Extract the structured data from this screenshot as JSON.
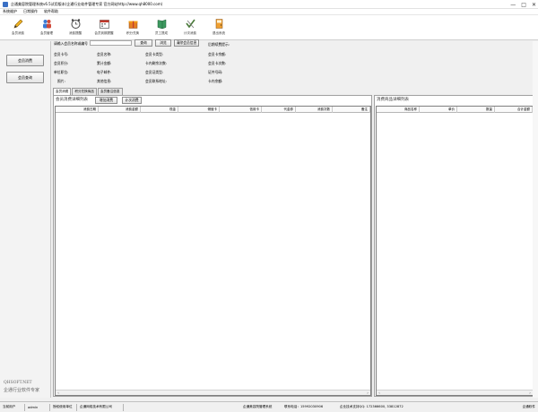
{
  "window": {
    "title": "企通美容院管理系统v6.5试用版本(企通行业软件管理专家 官方网站http://www.qh8000.com)",
    "controls": [
      "—",
      "□",
      "✕"
    ]
  },
  "menu": [
    "系统维护",
    "日常操作",
    "软件帮助"
  ],
  "toolbar": [
    {
      "label": "会员消费",
      "icon": "pencil-icon",
      "color": "#e9a21b"
    },
    {
      "label": "会员管理",
      "icon": "members-icon",
      "color": "#3a7bd5"
    },
    {
      "label": "消费提醒",
      "icon": "alarm-clock-icon",
      "color": "#555555"
    },
    {
      "label": "会员到期提醒",
      "icon": "calendar-icon",
      "color": "#c0392b"
    },
    {
      "label": "积分兑换",
      "icon": "gift-icon",
      "color": "#e67e22"
    },
    {
      "label": "员工提成",
      "icon": "book-icon",
      "color": "#2c8a4b"
    },
    {
      "label": "计次消费",
      "icon": "tick-icon",
      "color": "#4a7a3a"
    },
    {
      "label": "退出系统",
      "icon": "exit-icon",
      "color": "#d35400"
    }
  ],
  "sidebar": {
    "buttons": [
      "会员消费",
      "会员查询"
    ],
    "brand_line1": "QHSOFT.NET",
    "brand_line2": "企通行业软件专家"
  },
  "form": {
    "prompt": "请输入会员名称或编号",
    "query_button": "查询",
    "browse_button": "浏览",
    "clear_button": "清除会员信息",
    "labels": {
      "card_no": "会员卡号:",
      "name": "会员名称:",
      "card_type": "会员卡类型:",
      "card_balance": "会员卡余额:",
      "points": "会员积分:",
      "total_spend": "累计金额:",
      "remaining_times": "卡内剩余次数:",
      "card_times": "会员卡次数:",
      "unit": "单位职位:",
      "email": "电子邮件:",
      "cert_type": "会员证类型:",
      "member_id": "证件号码:",
      "photo": "照片:",
      "other_info": "其他信息:",
      "address": "会员联系地址:",
      "card_amount": "卡内余额:",
      "birthday_reminder": "后期续费提示:"
    }
  },
  "tabs": [
    "会员消费",
    "积分兑换商品",
    "会员备注信息"
  ],
  "consume": {
    "section_title": "会员消费详细列表",
    "add_button": "增加消费",
    "times_button": "计次消费",
    "columns": [
      "消费日期",
      "消费金额",
      "现金",
      "储值卡",
      "信用卡",
      "代金券",
      "消费次数",
      "备注"
    ]
  },
  "goods": {
    "section_title": "消费商品详细列表",
    "columns": [
      "商品名称",
      "单价",
      "数量",
      "合计金额"
    ]
  },
  "status": {
    "user_label": "当前用户",
    "user": "admin",
    "license": "授权使用单位",
    "company": "企通网络技术有限公司",
    "system": "企通美容院管理系统",
    "phone": "联系电话：15992030906 ",
    "support": "企业技术支持QQ: 172366600, 33812872",
    "product": "企通软件"
  }
}
